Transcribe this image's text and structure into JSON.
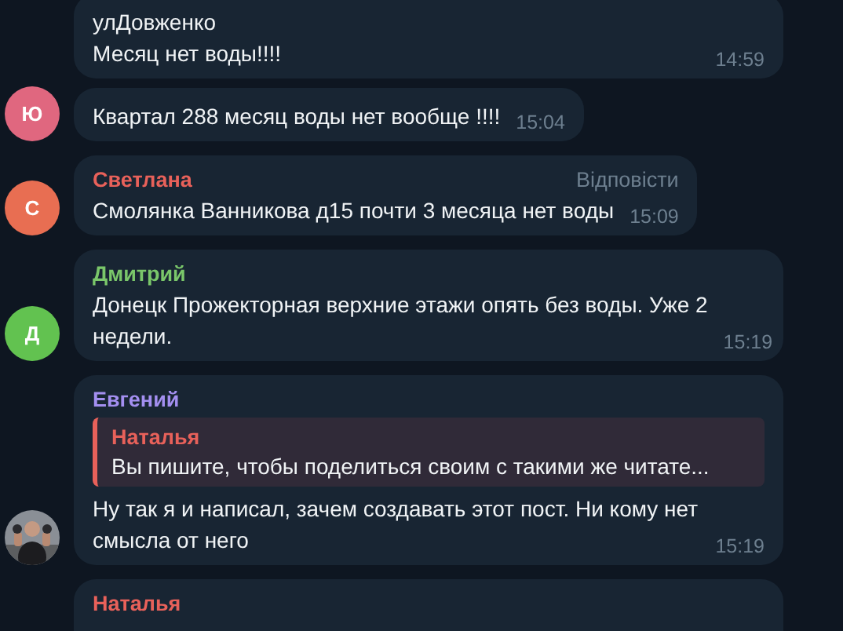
{
  "messages": [
    {
      "lines": [
        "улДовженко",
        "Месяц нет воды!!!!"
      ],
      "time": "14:59"
    },
    {
      "avatar": {
        "kind": "letter",
        "letter": "Ю",
        "color": "#e0677f"
      },
      "lines": [
        "Квартал 288 месяц воды нет вообще !!!!"
      ],
      "time": "15:04"
    },
    {
      "author": "Светлана",
      "color": "#e8615a",
      "reply_label": "Відповісти",
      "avatar": {
        "kind": "letter",
        "letter": "С",
        "color": "#e86e52"
      },
      "lines": [
        "Смолянка Ванникова д15 почти 3 месяца нет воды"
      ],
      "time": "15:09"
    },
    {
      "author": "Дмитрий",
      "color": "#7ac76a",
      "avatar": {
        "kind": "letter",
        "letter": "Д",
        "color": "#62c250"
      },
      "lines": [
        "Донецк Прожекторная верхние этажи опять без воды. Уже 2",
        "недели."
      ],
      "time": "15:19"
    },
    {
      "author": "Евгений",
      "color": "#a38ff0",
      "quote": {
        "author": "Наталья",
        "text": "Вы пишите, чтобы поделиться своим с такими же читате..."
      },
      "lines": [
        "Ну так я и написал, зачем создавать этот пост. Ни кому нет",
        "смысла от него"
      ],
      "time": "15:19"
    },
    {
      "author": "Наталья",
      "color": "#e8615a"
    }
  ]
}
